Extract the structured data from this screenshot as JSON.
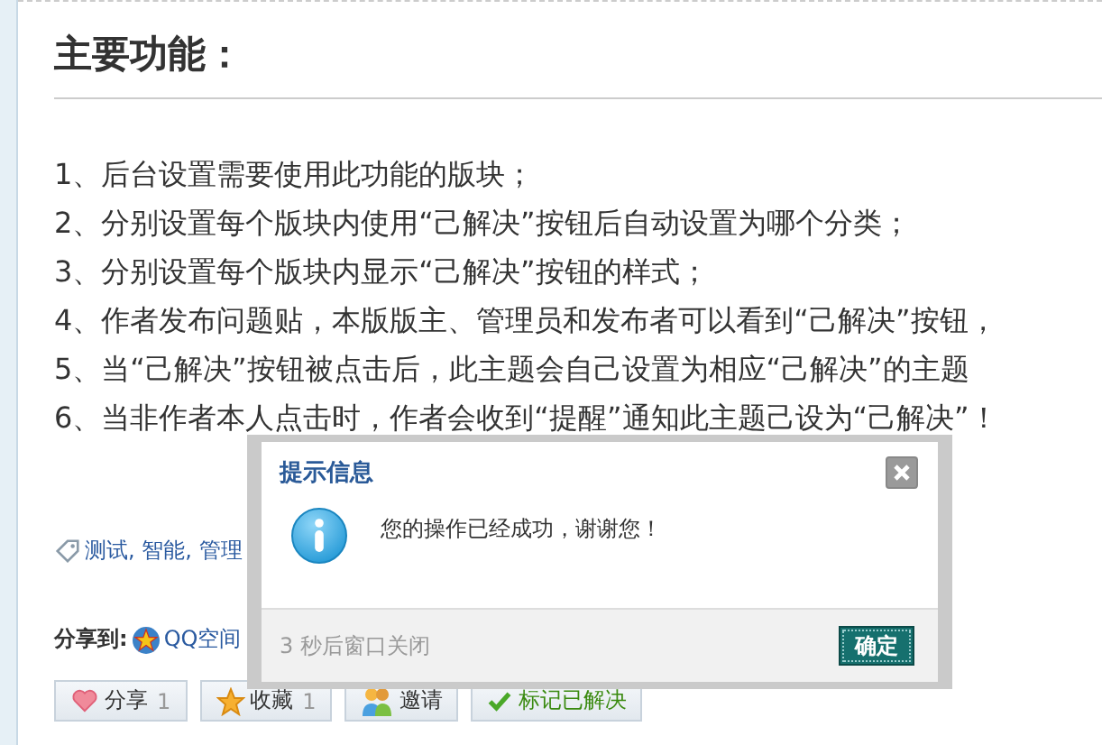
{
  "heading": "主要功能：",
  "features": [
    "1、后台设置需要使用此功能的版块；",
    "2、分别设置每个版块内使用“己解决”按钮后自动设置为哪个分类；",
    "3、分别设置每个版块内显示“己解决”按钮的样式；",
    "4、作者发布问题贴，本版版主、管理员和发布者可以看到“己解决”按钮，",
    "5、当“己解决”按钮被点击后，此主题会自己设置为相应“己解决”的主题",
    "6、当非作者本人点击时，作者会收到“提醒”通知此主题己设为“己解决”！"
  ],
  "tags": "测试, 智能, 管理",
  "share": {
    "label": "分享到:",
    "target": "QQ空间"
  },
  "actions": [
    {
      "kind": "heart",
      "label": "分享",
      "count": "1"
    },
    {
      "kind": "star",
      "label": "收藏",
      "count": "1"
    },
    {
      "kind": "people",
      "label": "邀请"
    },
    {
      "kind": "check",
      "label": "标记已解决"
    }
  ],
  "dialog": {
    "title": "提示信息",
    "message": "您的操作已经成功，谢谢您！",
    "countdown": "3 秒后窗口关闭",
    "button": "确定"
  }
}
